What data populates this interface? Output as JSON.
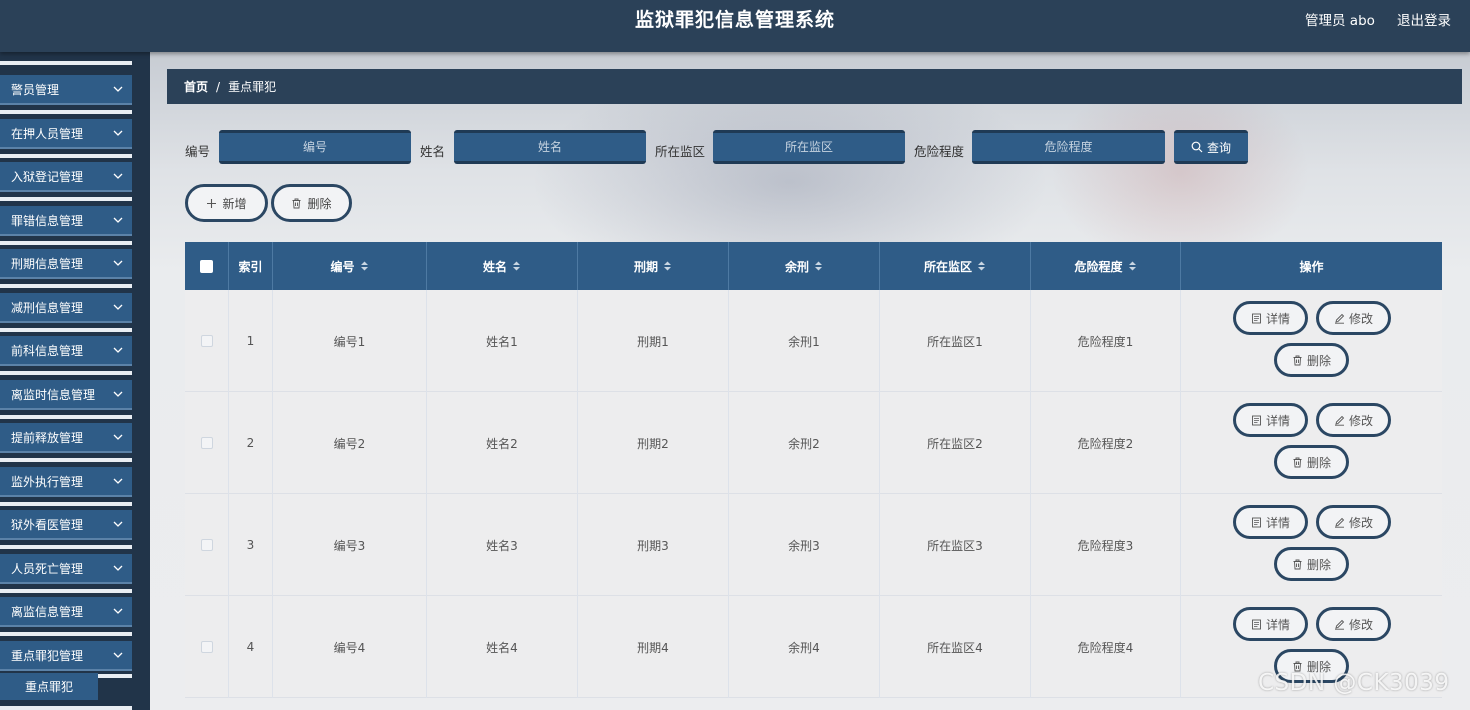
{
  "header": {
    "title": "监狱罪犯信息管理系统",
    "user": "管理员 abo",
    "logout": "退出登录"
  },
  "sidebar": {
    "items": [
      {
        "label": "警员管理"
      },
      {
        "label": "在押人员管理"
      },
      {
        "label": "入狱登记管理"
      },
      {
        "label": "罪错信息管理"
      },
      {
        "label": "刑期信息管理"
      },
      {
        "label": "减刑信息管理"
      },
      {
        "label": "前科信息管理"
      },
      {
        "label": "离监时信息管理"
      },
      {
        "label": "提前释放管理"
      },
      {
        "label": "监外执行管理"
      },
      {
        "label": "狱外看医管理"
      },
      {
        "label": "人员死亡管理"
      },
      {
        "label": "离监信息管理"
      },
      {
        "label": "重点罪犯管理"
      }
    ],
    "active_sub": "重点罪犯"
  },
  "breadcrumb": {
    "home": "首页",
    "separator": "/",
    "current": "重点罪犯"
  },
  "search": {
    "fields": [
      {
        "label": "编号",
        "placeholder": "编号"
      },
      {
        "label": "姓名",
        "placeholder": "姓名"
      },
      {
        "label": "所在监区",
        "placeholder": "所在监区"
      },
      {
        "label": "危险程度",
        "placeholder": "危险程度"
      }
    ],
    "button": "查询"
  },
  "actions": {
    "add": "新增",
    "delete": "删除"
  },
  "table": {
    "headers": [
      "索引",
      "编号",
      "姓名",
      "刑期",
      "余刑",
      "所在监区",
      "危险程度",
      "操作"
    ],
    "rows": [
      {
        "index": "1",
        "code": "编号1",
        "name": "姓名1",
        "term": "刑期1",
        "remaining": "余刑1",
        "area": "所在监区1",
        "danger": "危险程度1"
      },
      {
        "index": "2",
        "code": "编号2",
        "name": "姓名2",
        "term": "刑期2",
        "remaining": "余刑2",
        "area": "所在监区2",
        "danger": "危险程度2"
      },
      {
        "index": "3",
        "code": "编号3",
        "name": "姓名3",
        "term": "刑期3",
        "remaining": "余刑3",
        "area": "所在监区3",
        "danger": "危险程度3"
      },
      {
        "index": "4",
        "code": "编号4",
        "name": "姓名4",
        "term": "刑期4",
        "remaining": "余刑4",
        "area": "所在监区4",
        "danger": "危险程度4"
      }
    ],
    "row_actions": {
      "detail": "详情",
      "edit": "修改",
      "delete": "删除"
    }
  },
  "watermark": "CSDN @CK3039",
  "colors": {
    "header_bg": "#2b4158",
    "accent": "#2f5c87",
    "button_border": "#2b4763"
  }
}
